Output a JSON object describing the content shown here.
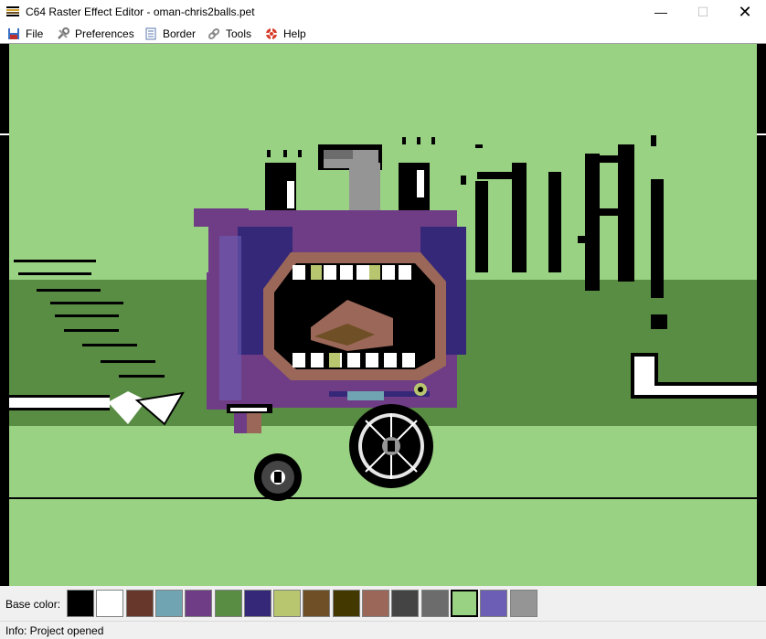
{
  "window": {
    "title": "C64 Raster Effect Editor - oman-chris2balls.pet"
  },
  "menu": [
    {
      "label": "File",
      "icon": "save-icon"
    },
    {
      "label": "Preferences",
      "icon": "tools-icon"
    },
    {
      "label": "Border",
      "icon": "document-icon"
    },
    {
      "label": "Tools",
      "icon": "chain-icon"
    },
    {
      "label": "Help",
      "icon": "lifebuoy-icon"
    }
  ],
  "palette": {
    "label": "Base color:",
    "colors": [
      "#000000",
      "#ffffff",
      "#68372b",
      "#70a4b2",
      "#6f3d86",
      "#588d43",
      "#352879",
      "#b8c76f",
      "#6f4f25",
      "#433900",
      "#9a6759",
      "#444444",
      "#6c6c6c",
      "#9ad284",
      "#6c5eb5",
      "#959595"
    ],
    "selected_index": 13
  },
  "status": {
    "text": "Info: Project opened"
  }
}
